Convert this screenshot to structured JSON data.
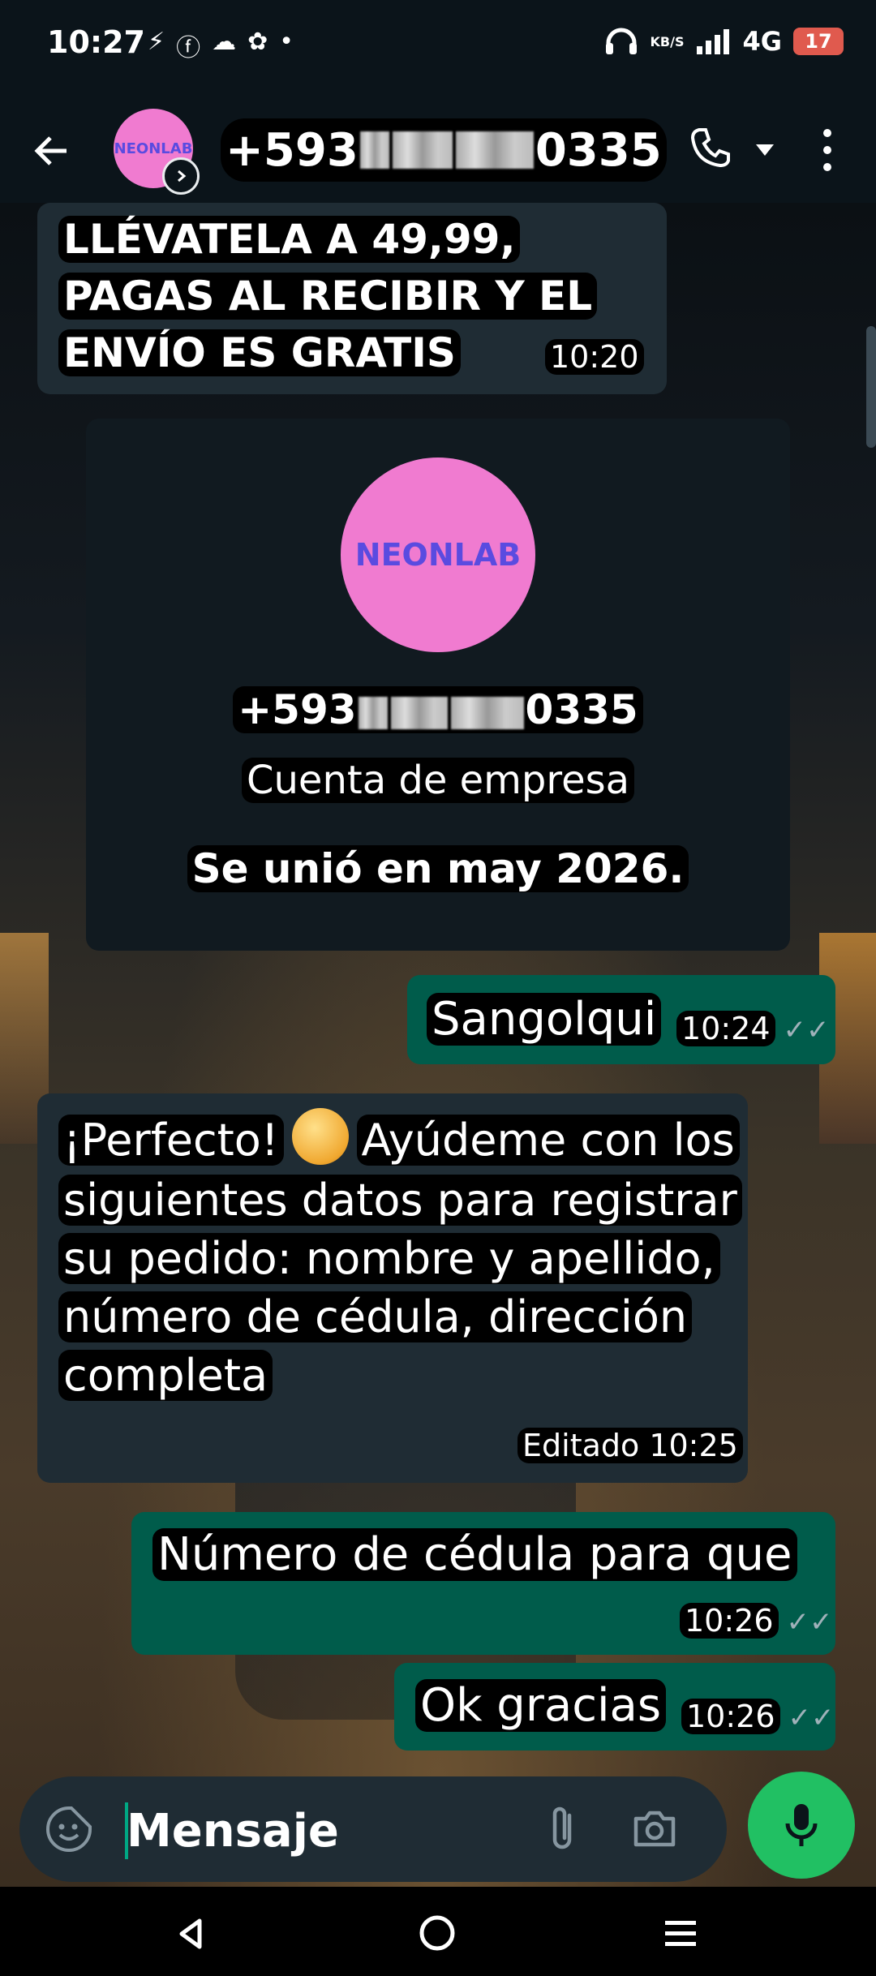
{
  "status_bar": {
    "time": "10:27",
    "network_speed": "KB/S",
    "network_type": "4G",
    "battery": "17",
    "icons": [
      "messenger-icon",
      "facebook-icon",
      "turtle-icon",
      "app-icon",
      "dot-icon",
      "headphones-icon",
      "signal-icon"
    ]
  },
  "header": {
    "avatar_text": "NEONLAB",
    "contact_prefix": "+593",
    "contact_suffix": "0335"
  },
  "messages": {
    "m1": {
      "text": "LLÉVATELA A 49,99, PAGAS AL RECIBIR Y EL ENVÍO ES GRATIS",
      "time": "10:20"
    },
    "business_card": {
      "avatar_text": "NEONLAB",
      "phone_prefix": "+593",
      "phone_suffix": "0335",
      "account_type": "Cuenta de empresa",
      "joined": "Se unió en may 2026."
    },
    "m2": {
      "text": "Sangolqui",
      "time": "10:24"
    },
    "m3": {
      "text_before_emoji": "¡Perfecto!",
      "text_after_emoji": "Ayúdeme con los siguientes datos para registrar su pedido: nombre y apellido, número de cédula, dirección completa",
      "edited_time": "Editado 10:25"
    },
    "m4": {
      "text": "Número de cédula para que",
      "time": "10:26"
    },
    "m5": {
      "text": "Ok gracias",
      "time": "10:26"
    }
  },
  "composer": {
    "placeholder": "Mensaje"
  },
  "colors": {
    "incoming_bubble": "#1f2c34",
    "outgoing_bubble": "#005c4b",
    "mic_button": "#21c063",
    "avatar_bg": "#f07bd0"
  }
}
